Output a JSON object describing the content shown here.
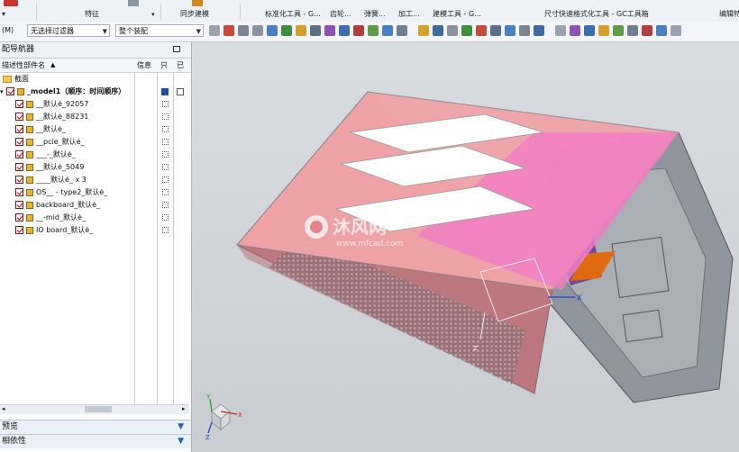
{
  "ribbon": {
    "groups": [
      "特征",
      "同步建模",
      "标准化工具 - G...",
      "齿轮...",
      "弹簧...",
      "加工...",
      "建模工具 - G...",
      "尺寸快速格式化工具 - GC工具箱",
      "编辑特"
    ],
    "colors": {
      "accent": "#1f5fa8"
    }
  },
  "toolbar": {
    "menu_label": "(M)",
    "filter_value": "无选择过滤器",
    "scope_value": "整个装配"
  },
  "navigator": {
    "title": "配导航器",
    "col_name": "描述性部件名",
    "col_info": "信息",
    "col_readonly": "只",
    "col_changed": "已",
    "section_label": "截面",
    "root": "_model1（顺序：时间顺序）",
    "items": [
      {
        "label": "__默认ė_92057"
      },
      {
        "label": "__默认ė_88231"
      },
      {
        "label": "__默认ė_"
      },
      {
        "label": "__pcie_默认ė_"
      },
      {
        "label": "___-_默认ė_"
      },
      {
        "label": "__默认ė_5049"
      },
      {
        "label": "____默认ė_ x 3"
      },
      {
        "label": "OS__ - type2_默认ė_"
      },
      {
        "label": "backboard_默认ė_"
      },
      {
        "label": "__-mid_默认ė_"
      },
      {
        "label": "IO board_默认ė_"
      }
    ],
    "panels": [
      {
        "label": "预览"
      },
      {
        "label": "相依性"
      }
    ]
  },
  "viewport": {
    "watermark_name": "沐风网",
    "watermark_url": "www.mfcad.com",
    "axis_x": "X",
    "axis_y": "Y",
    "axis_z": "Z",
    "colors": {
      "casing": "#e07a82",
      "lid_pink": "#f07fc4",
      "metal": "#9aa0a6",
      "purple": "#7a48a8",
      "orange": "#e06a10"
    }
  }
}
